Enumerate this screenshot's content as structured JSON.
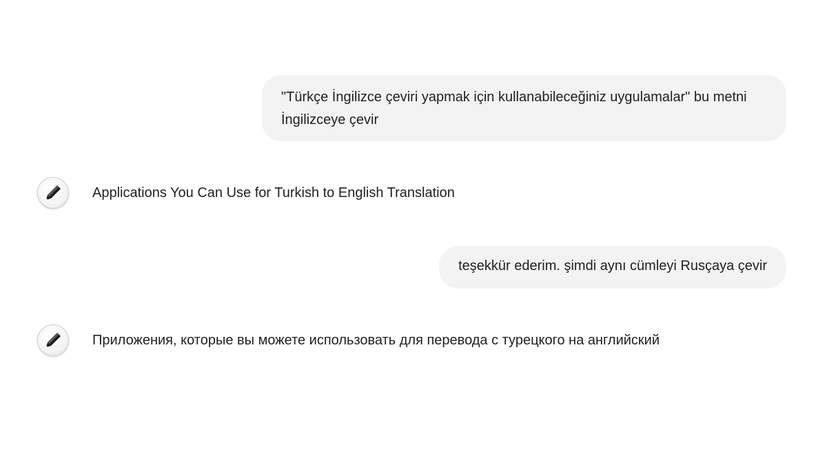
{
  "conversation": {
    "messages": [
      {
        "role": "user",
        "text": "\"Türkçe İngilizce çeviri yapmak için kullanabileceğiniz uygulamalar\" bu metni İngilizceye çevir"
      },
      {
        "role": "assistant",
        "icon": "pen-icon",
        "text": "Applications You Can Use for Turkish to English Translation"
      },
      {
        "role": "user",
        "text": "teşekkür ederim. şimdi aynı cümleyi Rusçaya çevir"
      },
      {
        "role": "assistant",
        "icon": "pen-icon",
        "text": "Приложения, которые вы можете использовать для перевода с турецкого на английский"
      }
    ]
  },
  "colors": {
    "user_bubble": "#f3f3f3",
    "text": "#1f1f1f",
    "background": "#ffffff"
  }
}
